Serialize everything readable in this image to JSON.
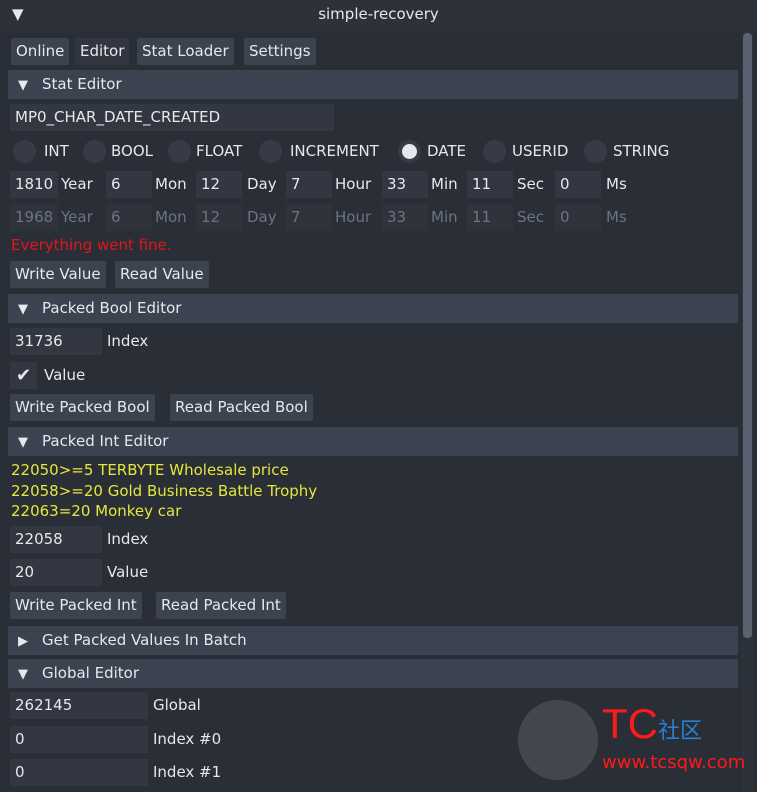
{
  "window": {
    "title": "simple-recovery",
    "collapse_icon": "triangle-down"
  },
  "tabs": [
    "Online",
    "Editor",
    "Stat Loader",
    "Settings"
  ],
  "stat_editor": {
    "header": "Stat Editor",
    "stat_name": "MP0_CHAR_DATE_CREATED",
    "types": [
      {
        "label": "INT",
        "selected": false
      },
      {
        "label": "BOOL",
        "selected": false
      },
      {
        "label": "FLOAT",
        "selected": false
      },
      {
        "label": "INCREMENT",
        "selected": false
      },
      {
        "label": "DATE",
        "selected": true
      },
      {
        "label": "USERID",
        "selected": false
      },
      {
        "label": "STRING",
        "selected": false
      }
    ],
    "date_inputs": [
      {
        "value": "1810",
        "label": "Year"
      },
      {
        "value": "6",
        "label": "Mon"
      },
      {
        "value": "12",
        "label": "Day"
      },
      {
        "value": "7",
        "label": "Hour"
      },
      {
        "value": "33",
        "label": "Min"
      },
      {
        "value": "11",
        "label": "Sec"
      },
      {
        "value": "0",
        "label": "Ms"
      }
    ],
    "date_current": [
      {
        "value": "1968",
        "label": "Year"
      },
      {
        "value": "6",
        "label": "Mon"
      },
      {
        "value": "12",
        "label": "Day"
      },
      {
        "value": "7",
        "label": "Hour"
      },
      {
        "value": "33",
        "label": "Min"
      },
      {
        "value": "11",
        "label": "Sec"
      },
      {
        "value": "0",
        "label": "Ms"
      }
    ],
    "status": "Everything went fine.",
    "status_color": "#e0161b",
    "write": "Write Value",
    "read": "Read Value"
  },
  "packed_bool": {
    "header": "Packed Bool Editor",
    "index_value": "31736",
    "index_label": "Index",
    "value_label": "Value",
    "checked": true,
    "write": "Write Packed Bool",
    "read": "Read Packed Bool"
  },
  "packed_int": {
    "header": "Packed Int Editor",
    "hints": [
      "22050>=5 TERBYTE Wholesale price",
      "22058>=20 Gold Business Battle Trophy",
      "22063=20 Monkey car"
    ],
    "hint_color": "#e5e83a",
    "index_value": "22058",
    "index_label": "Index",
    "value": "20",
    "value_label": "Value",
    "write": "Write Packed Int",
    "read": "Read Packed Int"
  },
  "batch": {
    "header": "Get Packed Values In Batch"
  },
  "global_editor": {
    "header": "Global Editor",
    "global_value": "262145",
    "global_label": "Global",
    "index0_value": "0",
    "index0_label": "Index #0",
    "index1_value": "0",
    "index1_label": "Index #1"
  },
  "watermark": {
    "logo": "TC社区",
    "url": "www.tcsqw.com"
  }
}
